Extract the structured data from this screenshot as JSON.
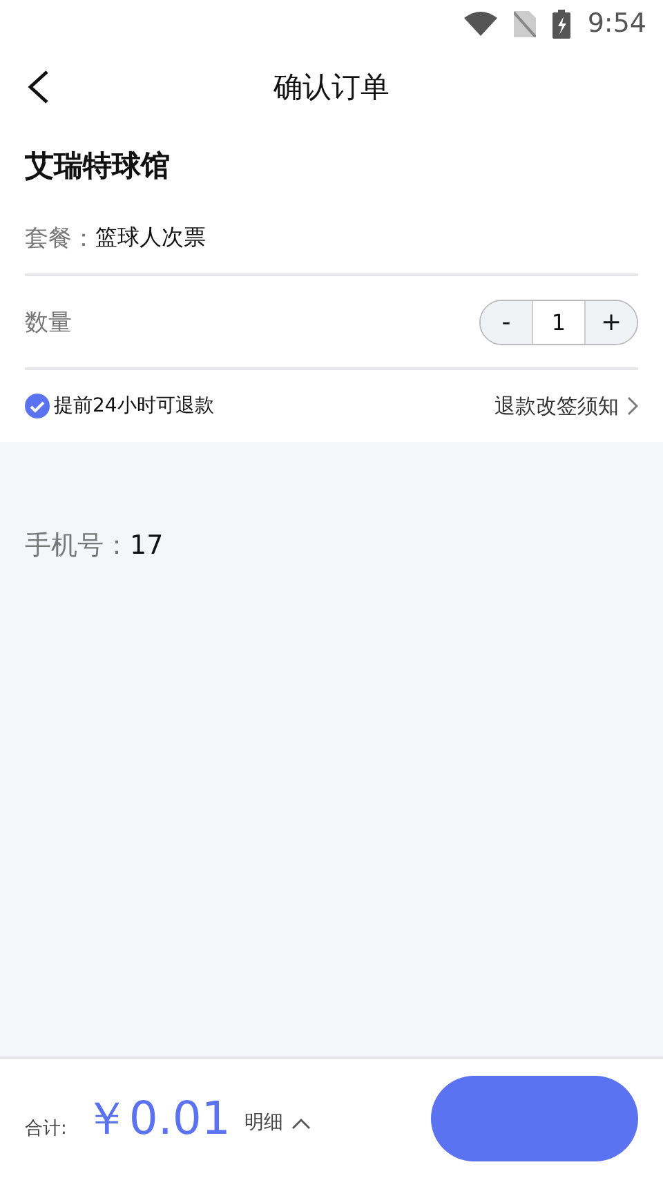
{
  "status_bar": {
    "time": "9:54"
  },
  "header": {
    "title": "确认订单"
  },
  "venue": {
    "name": "艾瑞特球馆"
  },
  "package": {
    "label": "套餐：",
    "value": "篮球人次票"
  },
  "quantity": {
    "label": "数量",
    "minus": "-",
    "value": "1",
    "plus": "+"
  },
  "refund": {
    "checked": true,
    "policy": "提前24小时可退款",
    "notice_link": "退款改签须知"
  },
  "phone": {
    "label": "手机号：",
    "value": "17"
  },
  "footer": {
    "total_label": "合计:",
    "amount": "￥0.01",
    "details": "明细"
  }
}
